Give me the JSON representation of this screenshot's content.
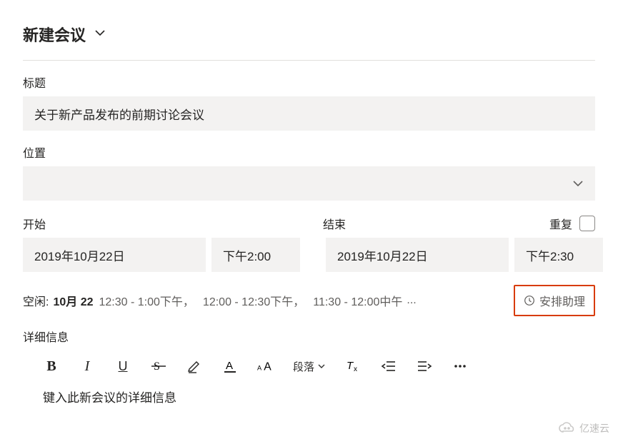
{
  "header": {
    "title": "新建会议"
  },
  "title_section": {
    "label": "标题",
    "value": "关于新产品发布的前期讨论会议"
  },
  "location_section": {
    "label": "位置",
    "value": ""
  },
  "start": {
    "label": "开始",
    "date": "2019年10月22日",
    "time": "下午2:00"
  },
  "end": {
    "label": "结束",
    "date": "2019年10月22日",
    "time": "下午2:30"
  },
  "repeat": {
    "label": "重复"
  },
  "freebusy": {
    "label": "空闲:",
    "date": "10月 22",
    "slots": [
      "12:30 - 1:00下午",
      "12:00 - 12:30下午",
      "11:30 - 12:00中午"
    ],
    "sep": "，",
    "more": "..."
  },
  "assistant": {
    "label": "安排助理"
  },
  "details": {
    "label": "详细信息",
    "placeholder": "键入此新会议的详细信息"
  },
  "toolbar": {
    "paragraph_label": "段落"
  },
  "watermark": {
    "text": "亿速云"
  }
}
